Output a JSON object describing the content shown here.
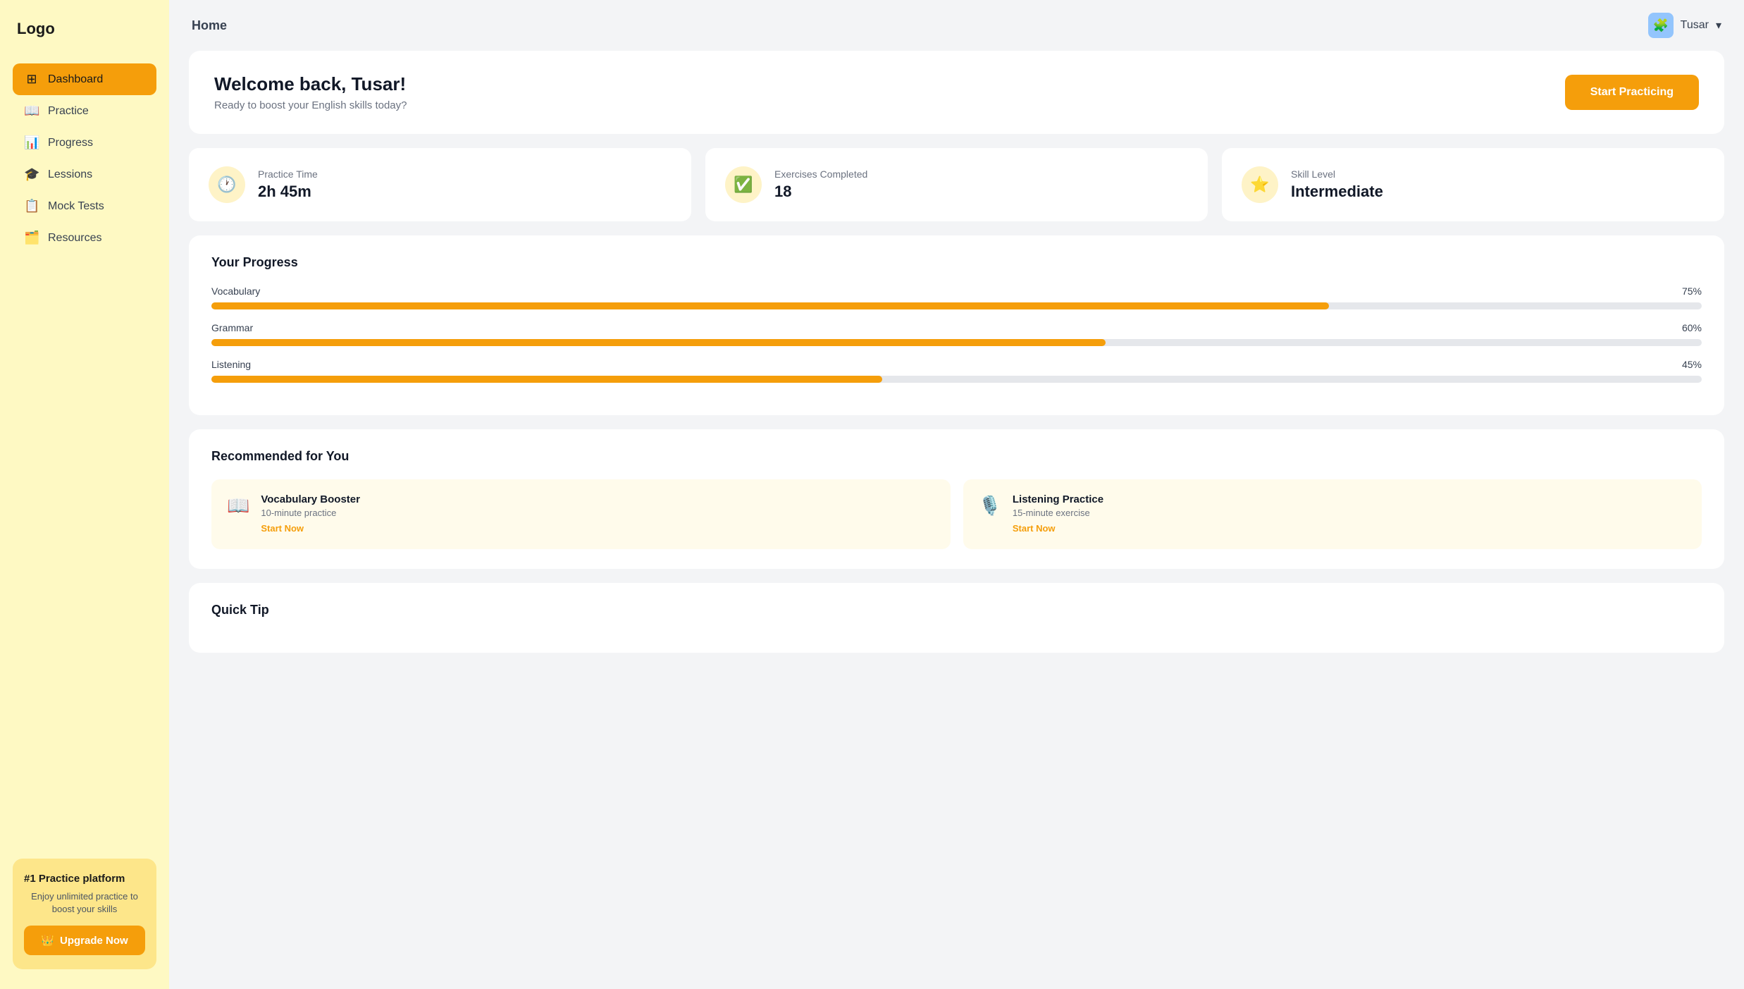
{
  "sidebar": {
    "logo": "Logo",
    "nav": [
      {
        "id": "dashboard",
        "label": "Dashboard",
        "icon": "⊞",
        "active": true
      },
      {
        "id": "practice",
        "label": "Practice",
        "icon": "📖"
      },
      {
        "id": "progress",
        "label": "Progress",
        "icon": "📊"
      },
      {
        "id": "lessons",
        "label": "Lessions",
        "icon": "🎓"
      },
      {
        "id": "mock-tests",
        "label": "Mock Tests",
        "icon": "📋"
      },
      {
        "id": "resources",
        "label": "Resources",
        "icon": "🗂️"
      }
    ],
    "promo": {
      "tag": "#1 Practice platform",
      "desc": "Enjoy unlimited practice to boost your skills",
      "upgrade_label": "Upgrade Now",
      "crown_icon": "👑"
    }
  },
  "topbar": {
    "title": "Home",
    "user": {
      "name": "Tusar",
      "avatar_icon": "🧩"
    }
  },
  "welcome": {
    "title": "Welcome back, Tusar!",
    "subtitle": "Ready to boost your English skills today?",
    "cta": "Start Practicing"
  },
  "stats": [
    {
      "id": "practice-time",
      "label": "Practice Time",
      "value": "2h 45m",
      "icon": "🕐"
    },
    {
      "id": "exercises-completed",
      "label": "Exercises Completed",
      "value": "18",
      "icon": "✅"
    },
    {
      "id": "skill-level",
      "label": "Skill Level",
      "value": "Intermediate",
      "icon": "⭐"
    }
  ],
  "progress": {
    "title": "Your Progress",
    "items": [
      {
        "label": "Vocabulary",
        "pct": 75,
        "pct_label": "75%"
      },
      {
        "label": "Grammar",
        "pct": 60,
        "pct_label": "60%"
      },
      {
        "label": "Listening",
        "pct": 45,
        "pct_label": "45%"
      }
    ]
  },
  "recommended": {
    "title": "Recommended for You",
    "items": [
      {
        "name": "Vocabulary Booster",
        "sub": "10-minute practice",
        "link": "Start Now",
        "icon": "📖"
      },
      {
        "name": "Listening Practice",
        "sub": "15-minute exercise",
        "link": "Start Now",
        "icon": "🎙️"
      }
    ]
  },
  "quick_tip": {
    "title": "Quick Tip"
  }
}
